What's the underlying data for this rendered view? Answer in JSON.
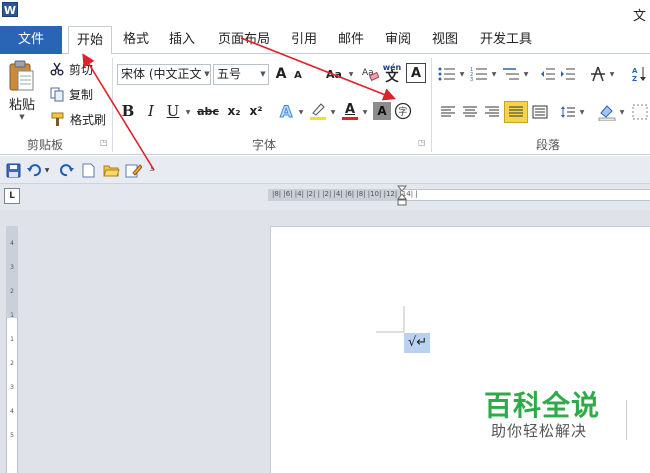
{
  "window": {
    "logo": "W",
    "title_partial": "文"
  },
  "tabs": [
    {
      "name": "tab-file",
      "label": "文件"
    },
    {
      "name": "tab-home",
      "label": "开始"
    },
    {
      "name": "tab-format",
      "label": "格式"
    },
    {
      "name": "tab-insert",
      "label": "插入"
    },
    {
      "name": "tab-page-layout",
      "label": "页面布局"
    },
    {
      "name": "tab-references",
      "label": "引用"
    },
    {
      "name": "tab-mailings",
      "label": "邮件"
    },
    {
      "name": "tab-review",
      "label": "审阅"
    },
    {
      "name": "tab-view",
      "label": "视图"
    },
    {
      "name": "tab-developer",
      "label": "开发工具"
    }
  ],
  "clipboard": {
    "paste_label": "粘贴",
    "cut_label": "剪切",
    "copy_label": "复制",
    "format_painter_label": "格式刷",
    "group_label": "剪贴板"
  },
  "font": {
    "font_name": "宋体 (中文正文",
    "font_size": "五号",
    "grow": "A",
    "shrink": "A",
    "change_case": "Aa",
    "phonetic": "wén",
    "phonetic_char": "文",
    "char_border": "A",
    "bold": "B",
    "italic": "I",
    "underline": "U",
    "strikethrough": "abc",
    "subscript": "x₂",
    "superscript": "x²",
    "font_color_letter": "A",
    "char_shading": "A",
    "enclose_char": "字",
    "group_label": "字体"
  },
  "paragraph": {
    "group_label": "段落"
  },
  "ruler": {
    "h_ticks": "|8|  |6|  |4|  |2|  |  |2|  |4|  |6|  |8|  |10|  |12|  |14|  |",
    "v_ticks": [
      "4",
      "3",
      "2",
      "1",
      "",
      "1",
      "2",
      "3",
      "4",
      "5"
    ],
    "toggle_label": "L"
  },
  "document": {
    "selected_text": "√↵"
  },
  "watermark": {
    "title": "百科全说",
    "subtitle": "助你轻松解决"
  },
  "colors": {
    "file_tab": "#2a64b4",
    "arrow": "#e0202a",
    "highlight": "#f5d44a",
    "watermark": "#2faa48"
  }
}
